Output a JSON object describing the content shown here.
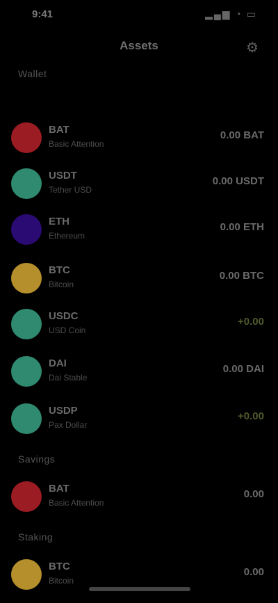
{
  "status_bar": {
    "time": "9:41",
    "icons": "▂▄▆ ◔ ▭"
  },
  "header": {
    "title": "Assets",
    "action_icon": "⚙"
  },
  "sections": {
    "wallet": "Wallet",
    "savings": "Savings",
    "staking": "Staking"
  },
  "wallet_assets": [
    {
      "symbol": "BAT",
      "name": "Basic Attention",
      "value": "0.00 BAT",
      "color": "#9c1c24"
    },
    {
      "symbol": "USDT",
      "name": "Tether USD",
      "value": "0.00 USDT",
      "color": "#2f8a6f"
    },
    {
      "symbol": "ETH",
      "name": "Ethereum",
      "value": "0.00 ETH",
      "color": "#2a0a73"
    },
    {
      "symbol": "BTC",
      "name": "Bitcoin",
      "value": "0.00 BTC",
      "color": "#b58f2c"
    },
    {
      "symbol": "USDC",
      "name": "USD Coin",
      "value": "+0.00",
      "color": "#2f8a6f"
    },
    {
      "symbol": "DAI",
      "name": "Dai Stable",
      "value": "0.00 DAI",
      "color": "#2f8a6f"
    },
    {
      "symbol": "USDP",
      "name": "Pax Dollar",
      "value": "+0.00",
      "color": "#2f8a6f"
    }
  ],
  "savings_assets": [
    {
      "symbol": "BAT",
      "name": "Basic Attention",
      "value": "0.00",
      "color": "#9c1c24"
    }
  ],
  "staking_assets": [
    {
      "symbol": "BTC",
      "name": "Bitcoin",
      "value": "0.00",
      "color": "#b58f2c"
    }
  ]
}
